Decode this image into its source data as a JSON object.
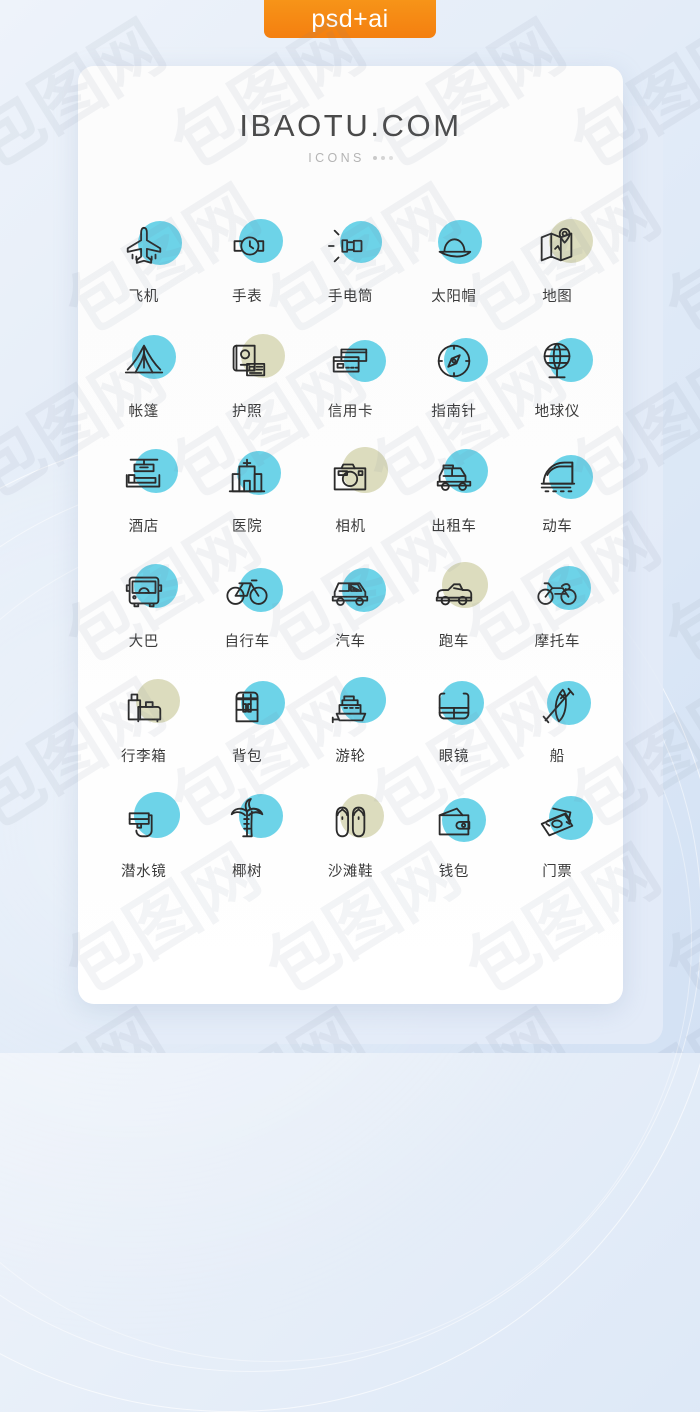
{
  "badge": {
    "label": "psd+ai"
  },
  "header": {
    "brand": "IBAOTU.COM",
    "subtitle": "ICONS"
  },
  "colors": {
    "accent_blue": "#6DD3E8",
    "accent_khaki": "#DCDCBE",
    "line": "#2b2b2b",
    "badge_orange": "#F47F10",
    "page_bg": "#DBE7F6",
    "card_bg": "#FCFCFC",
    "label_text": "#3B3B3B",
    "brand_text": "#4A4A4A",
    "subtitle_text": "#B4B4B4"
  },
  "watermark": {
    "text": "包图网"
  },
  "icons": [
    {
      "label": "飞机",
      "icon": "airplane-icon",
      "blob": "blue",
      "bx": 30,
      "by": 6,
      "bs": 44
    },
    {
      "label": "手表",
      "icon": "watch-icon",
      "blob": "blue",
      "bx": 28,
      "by": 4,
      "bs": 44
    },
    {
      "label": "手电筒",
      "icon": "flashlight-icon",
      "blob": "blue",
      "bx": 26,
      "by": 6,
      "bs": 42
    },
    {
      "label": "太阳帽",
      "icon": "sun-hat-icon",
      "blob": "blue",
      "bx": 20,
      "by": 5,
      "bs": 44
    },
    {
      "label": "地图",
      "icon": "map-icon",
      "blob": "khaki",
      "bx": 28,
      "by": 4,
      "bs": 44
    },
    {
      "label": "帐篷",
      "icon": "tent-icon",
      "blob": "blue",
      "bx": 24,
      "by": 5,
      "bs": 44
    },
    {
      "label": "护照",
      "icon": "passport-icon",
      "blob": "khaki",
      "bx": 30,
      "by": 4,
      "bs": 44
    },
    {
      "label": "信用卡",
      "icon": "credit-card-icon",
      "blob": "blue",
      "bx": 30,
      "by": 10,
      "bs": 42
    },
    {
      "label": "指南针",
      "icon": "compass-icon",
      "blob": "blue",
      "bx": 26,
      "by": 8,
      "bs": 44
    },
    {
      "label": "地球仪",
      "icon": "globe-icon",
      "blob": "blue",
      "bx": 28,
      "by": 8,
      "bs": 44
    },
    {
      "label": "酒店",
      "icon": "hotel-bed-icon",
      "blob": "blue",
      "bx": 26,
      "by": 4,
      "bs": 44
    },
    {
      "label": "医院",
      "icon": "hospital-icon",
      "blob": "blue",
      "bx": 26,
      "by": 6,
      "bs": 44
    },
    {
      "label": "相机",
      "icon": "camera-icon",
      "blob": "khaki",
      "bx": 28,
      "by": 2,
      "bs": 46
    },
    {
      "label": "出租车",
      "icon": "taxi-icon",
      "blob": "blue",
      "bx": 26,
      "by": 4,
      "bs": 44
    },
    {
      "label": "动车",
      "icon": "bullet-train-icon",
      "blob": "blue",
      "bx": 28,
      "by": 10,
      "bs": 44
    },
    {
      "label": "大巴",
      "icon": "bus-icon",
      "blob": "blue",
      "bx": 26,
      "by": 4,
      "bs": 44
    },
    {
      "label": "自行车",
      "icon": "bicycle-icon",
      "blob": "blue",
      "bx": 28,
      "by": 8,
      "bs": 44
    },
    {
      "label": "汽车",
      "icon": "car-icon",
      "blob": "blue",
      "bx": 28,
      "by": 8,
      "bs": 44
    },
    {
      "label": "跑车",
      "icon": "sports-car-icon",
      "blob": "khaki",
      "bx": 24,
      "by": 2,
      "bs": 46
    },
    {
      "label": "摩托车",
      "icon": "motorcycle-icon",
      "blob": "blue",
      "bx": 26,
      "by": 6,
      "bs": 44
    },
    {
      "label": "行李箱",
      "icon": "luggage-icon",
      "blob": "khaki",
      "bx": 28,
      "by": 4,
      "bs": 44
    },
    {
      "label": "背包",
      "icon": "backpack-icon",
      "blob": "blue",
      "bx": 30,
      "by": 6,
      "bs": 44
    },
    {
      "label": "游轮",
      "icon": "cruise-ship-icon",
      "blob": "blue",
      "bx": 26,
      "by": 2,
      "bs": 46
    },
    {
      "label": "眼镜",
      "icon": "goggles-icon",
      "blob": "blue",
      "bx": 22,
      "by": 6,
      "bs": 44
    },
    {
      "label": "船",
      "icon": "kayak-icon",
      "blob": "blue",
      "bx": 26,
      "by": 6,
      "bs": 44
    },
    {
      "label": "潜水镜",
      "icon": "diving-mask-icon",
      "blob": "blue",
      "bx": 26,
      "by": 2,
      "bs": 46
    },
    {
      "label": "椰树",
      "icon": "palm-tree-icon",
      "blob": "blue",
      "bx": 28,
      "by": 4,
      "bs": 44
    },
    {
      "label": "沙滩鞋",
      "icon": "flip-flops-icon",
      "blob": "khaki",
      "bx": 26,
      "by": 4,
      "bs": 44
    },
    {
      "label": "钱包",
      "icon": "wallet-icon",
      "blob": "blue",
      "bx": 24,
      "by": 8,
      "bs": 44
    },
    {
      "label": "门票",
      "icon": "ticket-money-icon",
      "blob": "blue",
      "bx": 28,
      "by": 6,
      "bs": 44
    }
  ]
}
